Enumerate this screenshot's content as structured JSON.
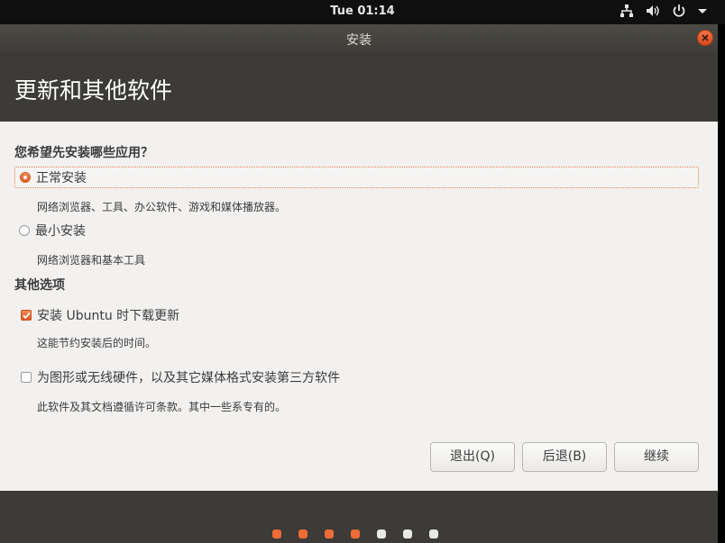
{
  "topbar": {
    "clock": "Tue 01:14"
  },
  "window": {
    "title": "安装"
  },
  "page": {
    "title": "更新和其他软件"
  },
  "install_question": "您希望先安装哪些应用？",
  "options": {
    "normal": {
      "label": "正常安装",
      "desc": "网络浏览器、工具、办公软件、游戏和媒体播放器。",
      "selected": true
    },
    "minimal": {
      "label": "最小安装",
      "desc": "网络浏览器和基本工具",
      "selected": false
    }
  },
  "other_heading": "其他选项",
  "checks": {
    "updates": {
      "label": "安装 Ubuntu 时下载更新",
      "desc": "这能节约安装后的时间。",
      "checked": true
    },
    "third_party": {
      "label": "为图形或无线硬件，以及其它媒体格式安装第三方软件",
      "desc": "此软件及其文档遵循许可条款。其中一些系专有的。",
      "checked": false
    }
  },
  "buttons": {
    "quit": "退出(Q)",
    "back": "后退(B)",
    "continue": "继续"
  },
  "progress": {
    "completed_steps": 4,
    "total_steps": 7
  },
  "colors": {
    "accent": "#ef6c36",
    "header": "#3c3b37",
    "content": "#f2f1f0"
  }
}
